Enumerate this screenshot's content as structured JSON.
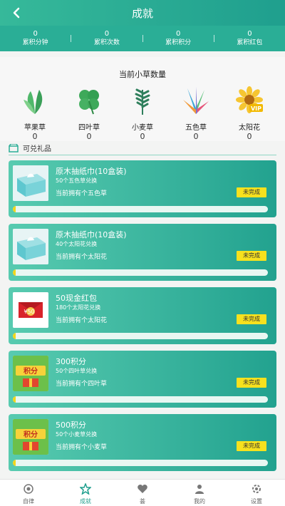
{
  "header": {
    "title": "成就",
    "back_icon": "chevron-left-icon"
  },
  "stats": [
    {
      "value": "0",
      "label": "累积分钟"
    },
    {
      "value": "0",
      "label": "累积次数"
    },
    {
      "value": "0",
      "label": "累积积分"
    },
    {
      "value": "0",
      "label": "累积红包"
    }
  ],
  "grass": {
    "title": "当前小草数量",
    "items": [
      {
        "name": "苹果草",
        "count": "0",
        "icon": "apple-grass-icon"
      },
      {
        "name": "四叶草",
        "count": "0",
        "icon": "clover-icon"
      },
      {
        "name": "小麦草",
        "count": "0",
        "icon": "wheatgrass-icon"
      },
      {
        "name": "五色草",
        "count": "0",
        "icon": "five-color-grass-icon"
      },
      {
        "name": "太阳花",
        "count": "0",
        "icon": "sunflower-vip-icon"
      }
    ]
  },
  "gifts": {
    "title": "可兑礼品",
    "items": [
      {
        "name": "原木抽纸巾(10盒装)",
        "requirement": "50个五色草兑换",
        "owned": "当前拥有个五色草",
        "status": "未完成",
        "progress": 0.0,
        "image": "tissue-box-image"
      },
      {
        "name": "原木抽纸巾(10盒装)",
        "requirement": "40个太阳花兑换",
        "owned": "当前拥有个太阳花",
        "status": "未完成",
        "progress": 0.0,
        "image": "tissue-box-image"
      },
      {
        "name": "50现金红包",
        "requirement": "180个太阳花兑换",
        "owned": "当前拥有个太阳花",
        "status": "未完成",
        "progress": 0.0,
        "image": "red-envelope-image"
      },
      {
        "name": "300积分",
        "requirement": "50个四叶草兑换",
        "owned": "当前拥有个四叶草",
        "status": "未完成",
        "progress": 0.0,
        "image": "points-exchange-image"
      },
      {
        "name": "500积分",
        "requirement": "50个小麦草兑换",
        "owned": "当前拥有个小麦草",
        "status": "未完成",
        "progress": 0.0,
        "image": "points-exchange-image"
      }
    ]
  },
  "nav": [
    {
      "label": "自律",
      "icon": "eye-icon",
      "active": false
    },
    {
      "label": "成就",
      "icon": "star-badge-icon",
      "active": true
    },
    {
      "label": "荟",
      "icon": "heart-icon",
      "active": false
    },
    {
      "label": "我的",
      "icon": "user-icon",
      "active": false
    },
    {
      "label": "设置",
      "icon": "settings-icon",
      "active": false
    }
  ],
  "colors": {
    "primary": "#2aae96",
    "accent_yellow": "#f7e11e",
    "card_start": "#58cbb0",
    "card_end": "#22a28f"
  }
}
